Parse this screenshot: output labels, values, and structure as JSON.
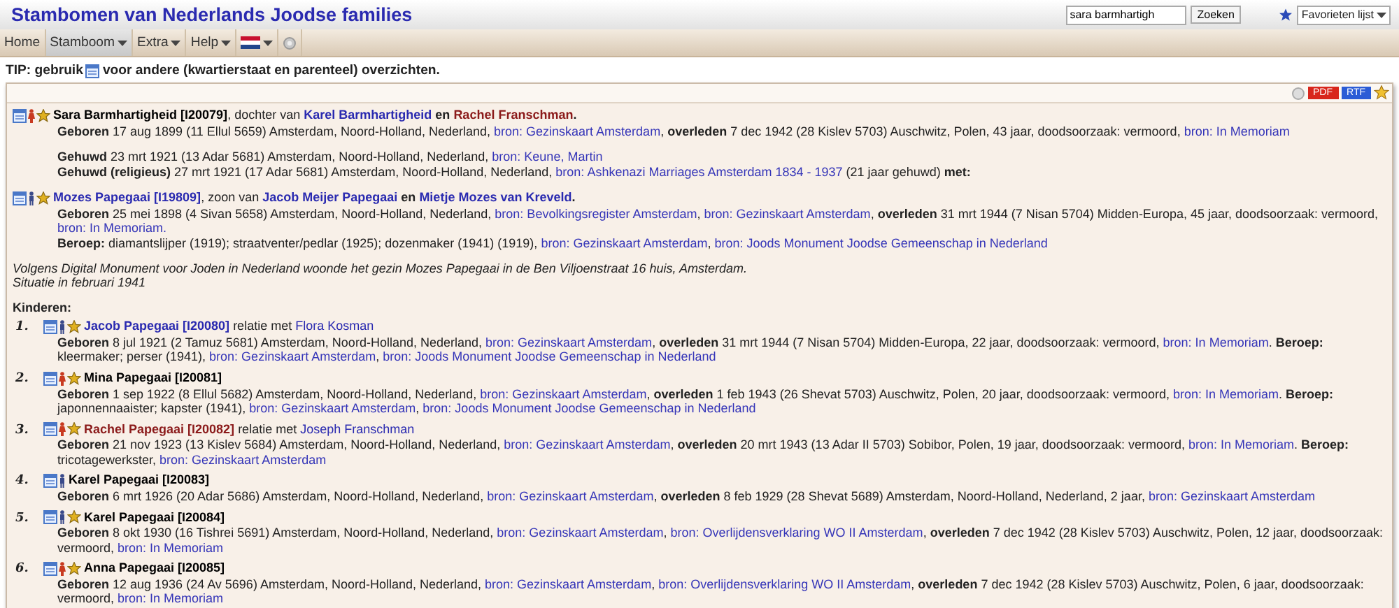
{
  "header": {
    "title": "Stambomen van Nederlands Joodse families",
    "search": {
      "value": "sara barmhartigh"
    },
    "search_button": "Zoeken",
    "favorites": "Favorieten lijst"
  },
  "menu": [
    {
      "label": "Home",
      "dropdown": false,
      "selected": false
    },
    {
      "label": "Stamboom",
      "dropdown": true,
      "selected": true
    },
    {
      "label": "Extra",
      "dropdown": true,
      "selected": false
    },
    {
      "label": "Help",
      "dropdown": true,
      "selected": false
    }
  ],
  "tip": {
    "before": "TIP: gebruik",
    "after": "voor andere (kwartierstaat en parenteel) overzichten."
  },
  "toolbar": {
    "pdf": "PDF",
    "rtf": "RTF"
  },
  "main_person": {
    "female": true,
    "star": true,
    "heading": [
      {
        "kind": "person",
        "text": "Sara Barmhartigheid [I20079]",
        "color": "#000000",
        "bold": true
      },
      {
        "kind": "text",
        "text": ", dochter van "
      },
      {
        "kind": "person",
        "text": "Karel Barmhartigheid",
        "color": "#2a2ab0",
        "bold": true
      },
      {
        "kind": "text",
        "text": " **en** "
      },
      {
        "kind": "person",
        "text": "Rachel Franschman",
        "color": "#8b1a1a",
        "bold": true
      },
      {
        "kind": "text",
        "text": "**.**"
      }
    ],
    "lines": [
      [
        {
          "kind": "text",
          "text": "**Geboren** 17 aug 1899 (11 Ellul 5659) Amsterdam, Noord-Holland, Nederland, "
        },
        {
          "kind": "source",
          "text": "bron: Gezinskaart Amsterdam"
        },
        {
          "kind": "text",
          "text": ", **overleden** 7 dec 1942 (28 Kislev 5703) Auschwitz, Polen, 43 jaar, doodsoorzaak: vermoord, "
        },
        {
          "kind": "source",
          "text": "bron: In Memoriam"
        }
      ]
    ]
  },
  "marriage": [
    [
      {
        "kind": "text",
        "text": "**Gehuwd** 23 mrt 1921 (13 Adar 5681) Amsterdam, Noord-Holland, Nederland, "
      },
      {
        "kind": "source",
        "text": "bron: Keune, Martin"
      }
    ],
    [
      {
        "kind": "text",
        "text": "**Gehuwd (religieus)** 27 mrt 1921 (17 Adar 5681) Amsterdam, Noord-Holland, Nederland, "
      },
      {
        "kind": "source",
        "text": "bron: Ashkenazi Marriages Amsterdam 1834 - 1937"
      },
      {
        "kind": "text",
        "text": " (21 jaar gehuwd) **met:**"
      }
    ]
  ],
  "spouse": {
    "female": false,
    "star": true,
    "heading": [
      {
        "kind": "person",
        "text": "Mozes Papegaai [I19809]",
        "color": "#2a2ab0",
        "bold": true
      },
      {
        "kind": "text",
        "text": ", zoon van "
      },
      {
        "kind": "person",
        "text": "Jacob Meijer Papegaai",
        "color": "#2a2ab0",
        "bold": true
      },
      {
        "kind": "text",
        "text": " **en** "
      },
      {
        "kind": "person",
        "text": "Mietje Mozes van Kreveld",
        "color": "#2a2ab0",
        "bold": true
      },
      {
        "kind": "text",
        "text": "**.**"
      }
    ],
    "lines": [
      [
        {
          "kind": "text",
          "text": "**Geboren** 25 mei 1898 (4 Sivan 5658) Amsterdam, Noord-Holland, Nederland, "
        },
        {
          "kind": "source",
          "text": "bron: Bevolkingsregister Amsterdam",
          "after": ", "
        },
        {
          "kind": "source",
          "text": "bron: Gezinskaart Amsterdam"
        },
        {
          "kind": "text",
          "text": ", **overleden** 31 mrt 1944 (7 Nisan 5704) Midden-Europa, 45 jaar, doodsoorzaak: vermoord, "
        },
        {
          "kind": "source",
          "text": "bron: In Memoriam."
        }
      ],
      [
        {
          "kind": "text",
          "text": "**Beroep:** diamantslijper (1919); straatventer/pedlar (1925); dozenmaker (1941) (1919), "
        },
        {
          "kind": "source",
          "text": "bron: Gezinskaart Amsterdam",
          "after": ", "
        },
        {
          "kind": "source",
          "text": "bron: Joods Monument Joodse Gemeenschap in Nederland"
        }
      ]
    ]
  },
  "note": [
    "Volgens Digital Monument voor Joden in Nederland woonde het gezin Mozes Papegaai in de Ben Viljoenstraat 16 huis, Amsterdam.",
    "Situatie in februari 1941"
  ],
  "children_title": "Kinderen:",
  "children": [
    {
      "number": "1.",
      "female": false,
      "star": true,
      "heading": [
        {
          "kind": "person",
          "text": "Jacob Papegaai [I20080]",
          "color": "#2a2ab0",
          "bold": true
        },
        {
          "kind": "text",
          "text": " relatie met "
        },
        {
          "kind": "person",
          "text": "Flora Kosman",
          "color": "#2a2ab0",
          "bold": false
        }
      ],
      "details": [
        {
          "kind": "text",
          "text": "**Geboren** 8 jul 1921 (2 Tamuz 5681) Amsterdam, Noord-Holland, Nederland, "
        },
        {
          "kind": "source",
          "text": "bron: Gezinskaart Amsterdam"
        },
        {
          "kind": "text",
          "text": ", **overleden** 31 mrt 1944 (7 Nisan 5704) Midden-Europa, 22 jaar, doodsoorzaak: vermoord, "
        },
        {
          "kind": "source",
          "text": "bron: In Memoriam"
        },
        {
          "kind": "text",
          "text": ". **Beroep:** kleermaker; perser (1941), "
        },
        {
          "kind": "source",
          "text": "bron: Gezinskaart Amsterdam",
          "after": ", "
        },
        {
          "kind": "source",
          "text": "bron: Joods Monument Joodse Gemeenschap in Nederland"
        }
      ]
    },
    {
      "number": "2.",
      "female": true,
      "star": true,
      "heading": [
        {
          "kind": "person",
          "text": "Mina Papegaai [I20081]",
          "color": "#000000",
          "bold": true
        }
      ],
      "details": [
        {
          "kind": "text",
          "text": "**Geboren** 1 sep 1922 (8 Ellul 5682) Amsterdam, Noord-Holland, Nederland, "
        },
        {
          "kind": "source",
          "text": "bron: Gezinskaart Amsterdam"
        },
        {
          "kind": "text",
          "text": ", **overleden** 1 feb 1943 (26 Shevat 5703) Auschwitz, Polen, 20 jaar, doodsoorzaak: vermoord, "
        },
        {
          "kind": "source",
          "text": "bron: In Memoriam"
        },
        {
          "kind": "text",
          "text": ". **Beroep:** japonnennaaister; kapster (1941), "
        },
        {
          "kind": "source",
          "text": "bron: Gezinskaart Amsterdam",
          "after": ", "
        },
        {
          "kind": "source",
          "text": "bron: Joods Monument Joodse Gemeenschap in Nederland"
        }
      ]
    },
    {
      "number": "3.",
      "female": true,
      "star": true,
      "heading": [
        {
          "kind": "person",
          "text": "Rachel Papegaai [I20082]",
          "color": "#8b1a1a",
          "bold": true
        },
        {
          "kind": "text",
          "text": " relatie met "
        },
        {
          "kind": "person",
          "text": "Joseph Franschman",
          "color": "#2a2ab0",
          "bold": false
        }
      ],
      "details": [
        {
          "kind": "text",
          "text": "**Geboren** 21 nov 1923 (13 Kislev 5684) Amsterdam, Noord-Holland, Nederland, "
        },
        {
          "kind": "source",
          "text": "bron: Gezinskaart Amsterdam"
        },
        {
          "kind": "text",
          "text": ", **overleden** 20 mrt 1943 (13 Adar II 5703) Sobibor, Polen, 19 jaar, doodsoorzaak: vermoord, "
        },
        {
          "kind": "source",
          "text": "bron: In Memoriam"
        },
        {
          "kind": "text",
          "text": ". **Beroep:** tricotagewerkster, "
        },
        {
          "kind": "source",
          "text": "bron: Gezinskaart Amsterdam"
        }
      ]
    },
    {
      "number": "4.",
      "female": false,
      "star": false,
      "heading": [
        {
          "kind": "person",
          "text": "Karel Papegaai [I20083]",
          "color": "#000000",
          "bold": true
        }
      ],
      "details": [
        {
          "kind": "text",
          "text": "**Geboren** 6 mrt 1926 (20 Adar 5686) Amsterdam, Noord-Holland, Nederland, "
        },
        {
          "kind": "source",
          "text": "bron: Gezinskaart Amsterdam"
        },
        {
          "kind": "text",
          "text": ", **overleden** 8 feb 1929 (28 Shevat 5689) Amsterdam, Noord-Holland, Nederland, 2 jaar, "
        },
        {
          "kind": "source",
          "text": "bron: Gezinskaart Amsterdam"
        }
      ]
    },
    {
      "number": "5.",
      "female": false,
      "star": true,
      "heading": [
        {
          "kind": "person",
          "text": "Karel Papegaai [I20084]",
          "color": "#000000",
          "bold": true
        }
      ],
      "details": [
        {
          "kind": "text",
          "text": "**Geboren** 8 okt 1930 (16 Tishrei 5691) Amsterdam, Noord-Holland, Nederland, "
        },
        {
          "kind": "source",
          "text": "bron: Gezinskaart Amsterdam",
          "after": ", "
        },
        {
          "kind": "source",
          "text": "bron: Overlijdensverklaring WO II Amsterdam"
        },
        {
          "kind": "text",
          "text": ", **overleden** 7 dec 1942 (28 Kislev 5703) Auschwitz, Polen, 12 jaar, doodsoorzaak: vermoord, "
        },
        {
          "kind": "source",
          "text": "bron: In Memoriam"
        }
      ]
    },
    {
      "number": "6.",
      "female": true,
      "star": true,
      "heading": [
        {
          "kind": "person",
          "text": "Anna Papegaai [I20085]",
          "color": "#000000",
          "bold": true
        }
      ],
      "details": [
        {
          "kind": "text",
          "text": "**Geboren** 12 aug 1936 (24 Av 5696) Amsterdam, Noord-Holland, Nederland, "
        },
        {
          "kind": "source",
          "text": "bron: Gezinskaart Amsterdam",
          "after": ", "
        },
        {
          "kind": "source",
          "text": "bron: Overlijdensverklaring WO II Amsterdam"
        },
        {
          "kind": "text",
          "text": ", **overleden** 7 dec 1942 (28 Kislev 5703) Auschwitz, Polen, 6 jaar, doodsoorzaak: vermoord, "
        },
        {
          "kind": "source",
          "text": "bron: In Memoriam"
        }
      ]
    }
  ]
}
